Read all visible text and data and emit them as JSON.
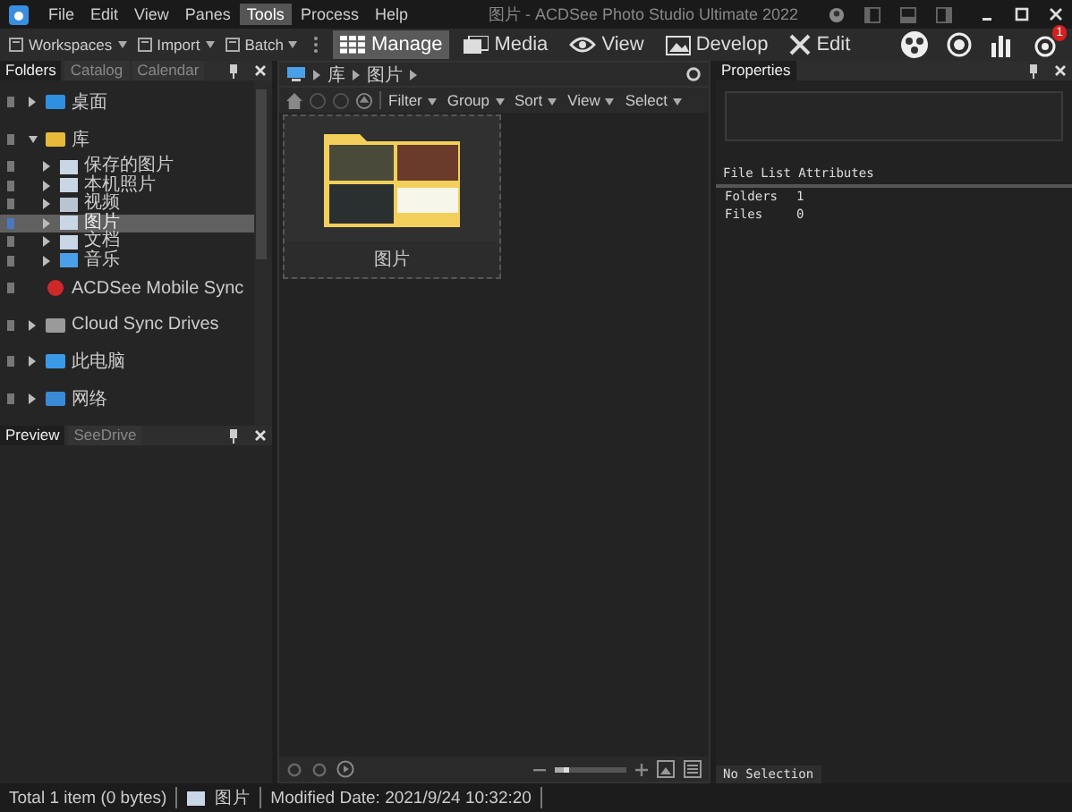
{
  "window": {
    "title": "图片 - ACDSee Photo Studio Ultimate 2022"
  },
  "menu": [
    {
      "label": "File",
      "selected": false
    },
    {
      "label": "Edit",
      "selected": false
    },
    {
      "label": "View",
      "selected": false
    },
    {
      "label": "Panes",
      "selected": false
    },
    {
      "label": "Tools",
      "selected": true
    },
    {
      "label": "Process",
      "selected": false
    },
    {
      "label": "Help",
      "selected": false
    }
  ],
  "toolbar": [
    "Workspaces",
    "Import",
    "Batch"
  ],
  "modes": [
    {
      "label": "Manage",
      "kind": "grid",
      "selected": true
    },
    {
      "label": "Media",
      "kind": "media",
      "selected": false
    },
    {
      "label": "View",
      "kind": "eye",
      "selected": false
    },
    {
      "label": "Develop",
      "kind": "photo",
      "selected": false
    },
    {
      "label": "Edit",
      "kind": "tools",
      "selected": false
    }
  ],
  "badge": "1",
  "folders_pane": {
    "tabs": [
      {
        "label": "Folders",
        "selected": true
      },
      {
        "label": "Catalog",
        "selected": false
      },
      {
        "label": "Calendar",
        "selected": false
      }
    ],
    "tree": [
      {
        "label": "桌面",
        "kind": "desktop",
        "expandable": true,
        "expanded": false,
        "selected": false
      },
      {
        "label": "库",
        "kind": "library",
        "expandable": true,
        "expanded": true,
        "selected": false,
        "children": [
          {
            "label": "保存的图片",
            "kind": "pictures",
            "expandable": true,
            "expanded": false,
            "selected": false
          },
          {
            "label": "本机照片",
            "kind": "pictures",
            "expandable": true,
            "expanded": false,
            "selected": false
          },
          {
            "label": "视频",
            "kind": "video",
            "expandable": true,
            "expanded": false,
            "selected": false
          },
          {
            "label": "图片",
            "kind": "pictures",
            "expandable": true,
            "expanded": false,
            "selected": true
          },
          {
            "label": "文档",
            "kind": "documents",
            "expandable": true,
            "expanded": false,
            "selected": false
          },
          {
            "label": "音乐",
            "kind": "music",
            "expandable": true,
            "expanded": false,
            "selected": false
          }
        ]
      },
      {
        "label": "ACDSee Mobile Sync",
        "kind": "sync",
        "expandable": false,
        "selected": false
      },
      {
        "label": "Cloud Sync Drives",
        "kind": "cloud",
        "expandable": true,
        "expanded": false,
        "selected": false
      },
      {
        "label": "此电脑",
        "kind": "computer",
        "expandable": true,
        "expanded": false,
        "selected": false
      },
      {
        "label": "网络",
        "kind": "network",
        "expandable": true,
        "expanded": false,
        "selected": false
      }
    ]
  },
  "preview_pane": {
    "tabs": [
      {
        "label": "Preview",
        "selected": true
      },
      {
        "label": "SeeDrive",
        "selected": false
      }
    ]
  },
  "breadcrumb": [
    "库",
    "图片"
  ],
  "filter_bar": [
    "Filter",
    "Group",
    "Sort",
    "View",
    "Select"
  ],
  "thumbnails": [
    {
      "label": "图片"
    }
  ],
  "zoom": {
    "level": 0.2
  },
  "properties": {
    "title": "Properties",
    "section": "File List Attributes",
    "rows": [
      {
        "label": "Folders",
        "value": "1"
      },
      {
        "label": "Files",
        "value": "0"
      }
    ],
    "footer_tab": "No Selection"
  },
  "status_bar": {
    "total": "Total 1 item  (0 bytes)",
    "folder": "图片",
    "modified": "Modified Date: 2021/9/24 10:32:20"
  }
}
